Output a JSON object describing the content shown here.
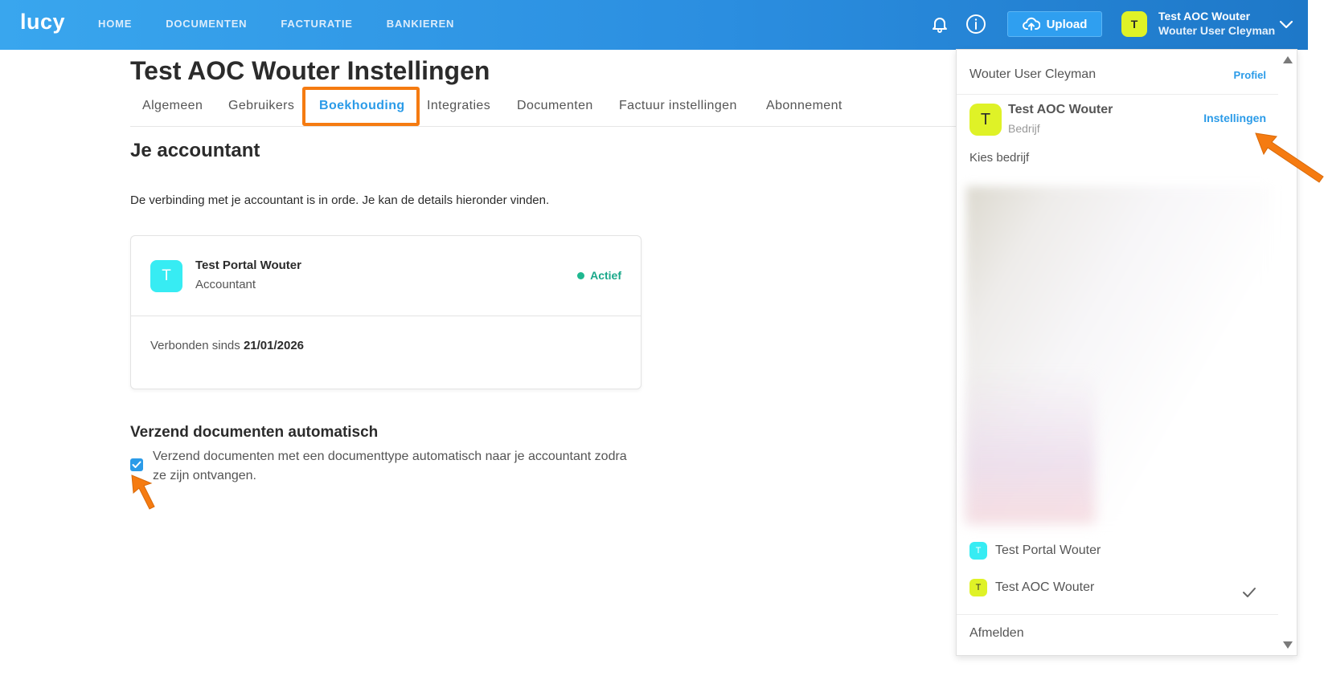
{
  "app": {
    "logo": "lucy"
  },
  "nav": [
    {
      "label": "HOME"
    },
    {
      "label": "DOCUMENTEN"
    },
    {
      "label": "FACTURATIE"
    },
    {
      "label": "BANKIEREN"
    }
  ],
  "header": {
    "upload_label": "Upload",
    "user_initial": "T",
    "user_company": "Test AOC Wouter",
    "user_name": "Wouter User Cleyman"
  },
  "page": {
    "title": "Test AOC Wouter Instellingen",
    "tabs": [
      {
        "label": "Algemeen"
      },
      {
        "label": "Gebruikers"
      },
      {
        "label": "Boekhouding"
      },
      {
        "label": "Integraties"
      },
      {
        "label": "Documenten"
      },
      {
        "label": "Factuur instellingen"
      },
      {
        "label": "Abonnement"
      }
    ],
    "active_tab": "Boekhouding"
  },
  "accountant": {
    "section_title": "Je accountant",
    "description": "De verbinding met je accountant is in orde. Je kan de details hieronder vinden.",
    "initial": "T",
    "name": "Test Portal Wouter",
    "role": "Accountant",
    "status": "Actief",
    "since_label": "Verbonden sinds",
    "since_date": "21/01/2026"
  },
  "auto_send": {
    "title": "Verzend documenten automatisch",
    "checked": true,
    "text": "Verzend documenten met een documenttype automatisch naar je accountant zodra ze zijn ontvangen."
  },
  "dropdown": {
    "user_name": "Wouter User Cleyman",
    "profile_link": "Profiel",
    "company_initial": "T",
    "company_name": "Test AOC Wouter",
    "company_type": "Bedrijf",
    "settings_link": "Instellingen",
    "choose_label": "Kies bedrijf",
    "companies": [
      {
        "initial": "T",
        "name": "Test Portal Wouter",
        "color": "#37ecf3",
        "selected": false
      },
      {
        "initial": "T",
        "name": "Test AOC Wouter",
        "color": "#dff227",
        "selected": true
      }
    ],
    "logout": "Afmelden"
  },
  "colors": {
    "brand_blue": "#2b9be8",
    "highlight_orange": "#f57b11",
    "status_green": "#1aa88a",
    "avatar_yellow": "#dff227",
    "avatar_cyan": "#37ecf3"
  }
}
